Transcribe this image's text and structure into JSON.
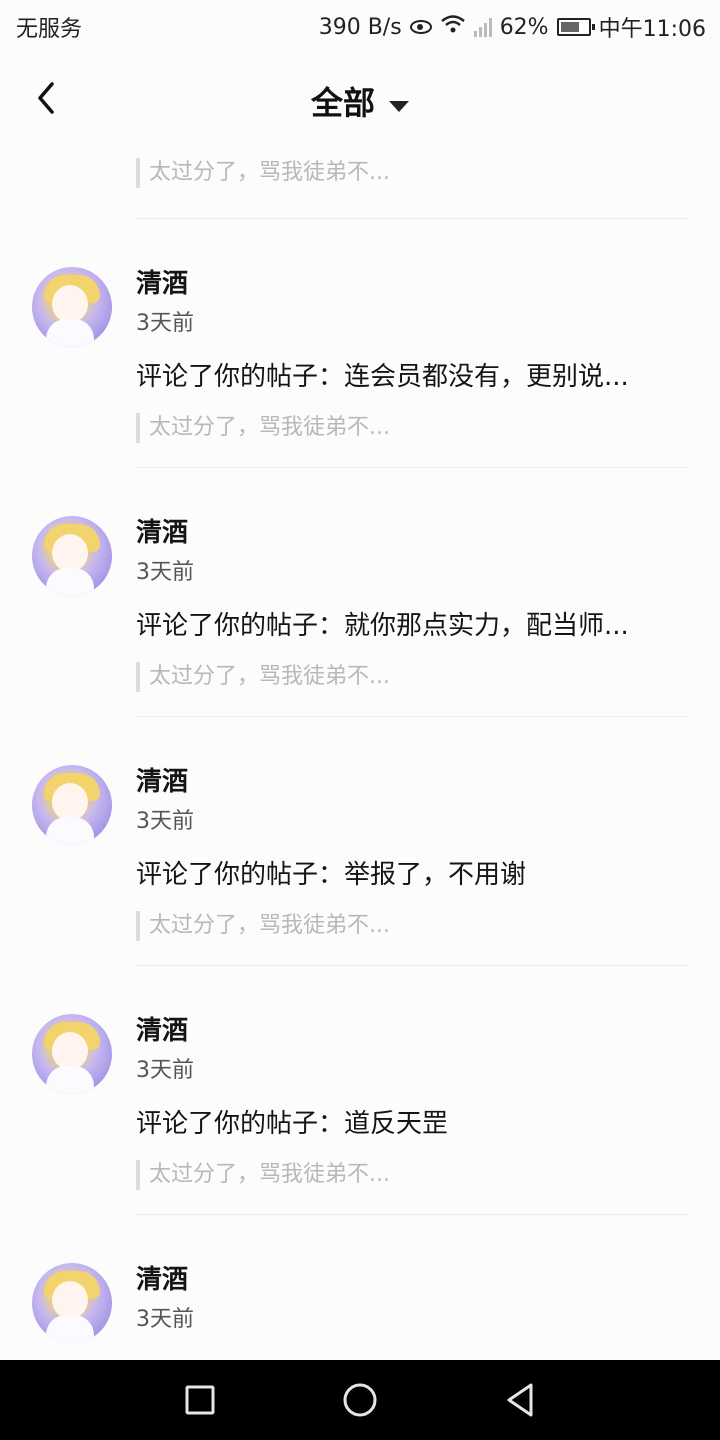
{
  "status_bar": {
    "carrier": "无服务",
    "speed": "390 B/s",
    "battery": "62%",
    "time": "中午11:06"
  },
  "header": {
    "title": "全部"
  },
  "top_quote": "太过分了，骂我徒弟不...",
  "items": [
    {
      "name": "清酒",
      "time": "3天前",
      "text": "评论了你的帖子：连会员都没有，更别说...",
      "quote": "太过分了，骂我徒弟不..."
    },
    {
      "name": "清酒",
      "time": "3天前",
      "text": "评论了你的帖子：就你那点实力，配当师...",
      "quote": "太过分了，骂我徒弟不..."
    },
    {
      "name": "清酒",
      "time": "3天前",
      "text": "评论了你的帖子：举报了，不用谢",
      "quote": "太过分了，骂我徒弟不..."
    },
    {
      "name": "清酒",
      "time": "3天前",
      "text": "评论了你的帖子：道反天罡",
      "quote": "太过分了，骂我徒弟不..."
    },
    {
      "name": "清酒",
      "time": "3天前"
    }
  ]
}
